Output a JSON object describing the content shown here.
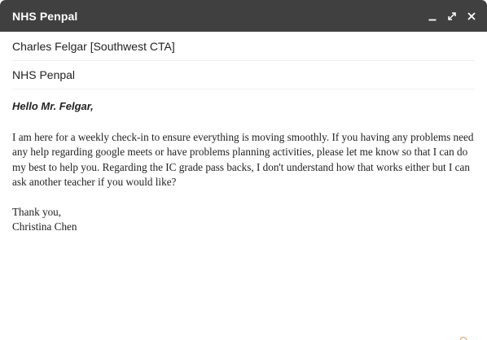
{
  "window": {
    "title": "NHS Penpal",
    "controls": {
      "minimize_icon": "minimize-icon",
      "expand_icon": "expand-icon",
      "close_icon": "close-icon"
    },
    "titlebar_color": "#404040"
  },
  "fields": {
    "to": "Charles Felgar [Southwest CTA]",
    "subject": "NHS Penpal"
  },
  "message": {
    "greeting": "Hello Mr. Felgar,",
    "paragraph": "I am here for a weekly check-in to ensure everything is moving smoothly. If you having any problems need any help regarding google meets or have problems planning activities, please let me know so that I can do my best to help you. Regarding the IC grade pass backs, I don't understand how that works either but I can ask another teacher if you would like?",
    "closing": "Thank you,",
    "signature": "Christina Chen"
  }
}
